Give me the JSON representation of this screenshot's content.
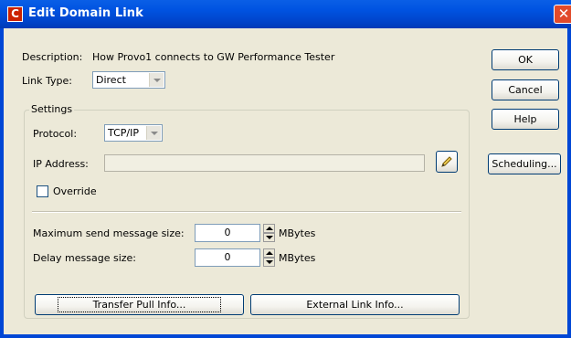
{
  "window": {
    "title": "Edit Domain Link",
    "app_icon_letter": "C"
  },
  "form": {
    "description_label": "Description:",
    "description_value": "How Provo1 connects to GW Performance Tester",
    "link_type_label": "Link Type:",
    "link_type_value": "Direct",
    "settings_title": "Settings",
    "protocol_label": "Protocol:",
    "protocol_value": "TCP/IP",
    "ip_address_label": "IP Address:",
    "ip_address_value": "",
    "override_label": "Override",
    "override_checked": false,
    "max_send_label": "Maximum send message size:",
    "max_send_value": "0",
    "max_send_unit": "MBytes",
    "delay_label": "Delay message size:",
    "delay_value": "0",
    "delay_unit": "MBytes",
    "transfer_pull_label": "Transfer Pull Info...",
    "external_link_label": "External Link Info..."
  },
  "buttons": {
    "ok": "OK",
    "cancel": "Cancel",
    "help": "Help",
    "scheduling": "Scheduling..."
  },
  "icons": {
    "close": "close-icon",
    "edit": "pencil-icon",
    "app": "app-icon"
  },
  "colors": {
    "titlebar": "#0054E3",
    "dialog_bg": "#ECE9D8",
    "close_button": "#E14A2A"
  }
}
